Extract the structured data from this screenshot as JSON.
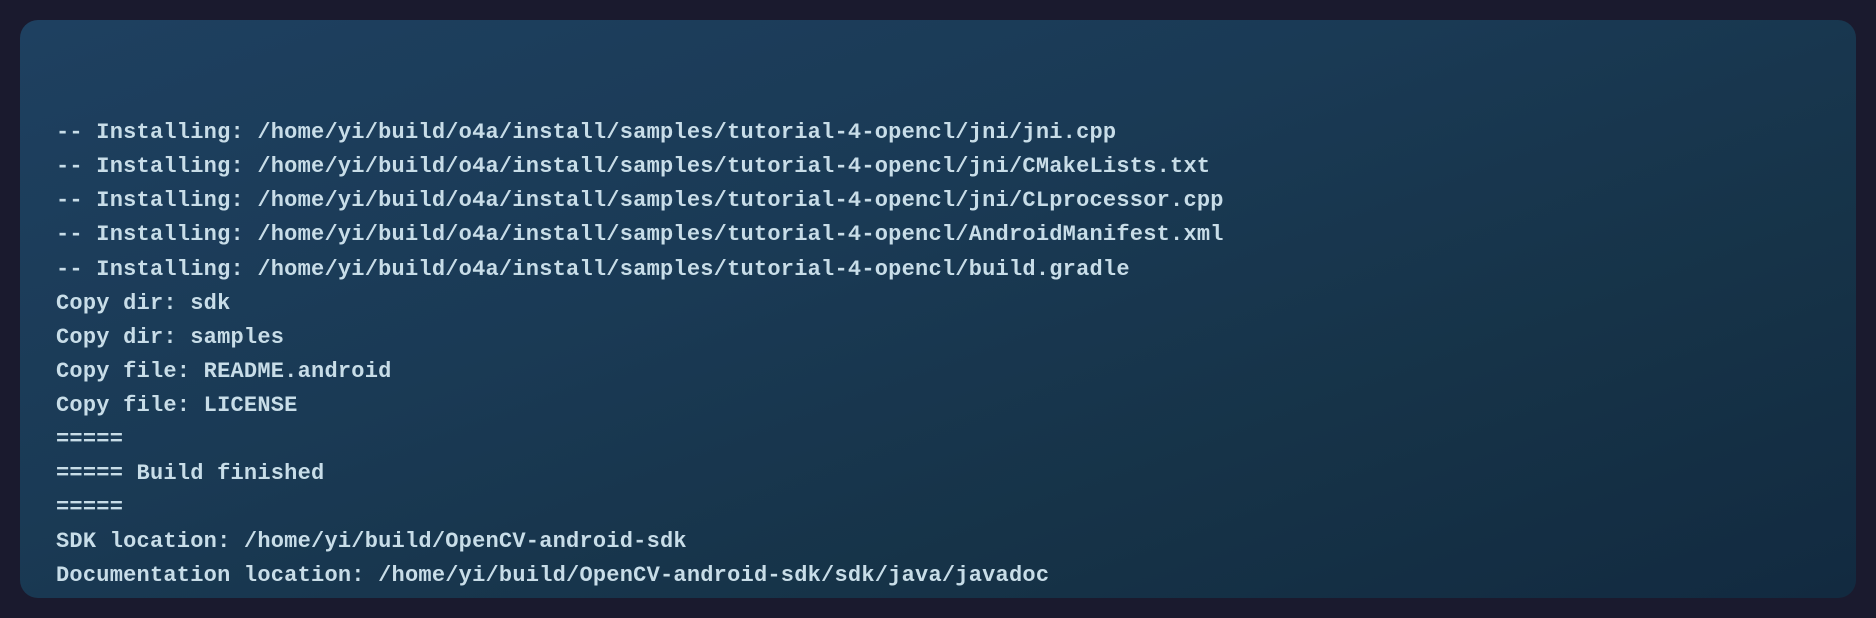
{
  "terminal": {
    "bg_color": "#1a3a55",
    "lines": [
      "-- Installing: /home/yi/build/o4a/install/samples/tutorial-4-opencl/jni/jni.cpp",
      "-- Installing: /home/yi/build/o4a/install/samples/tutorial-4-opencl/jni/CMakeLists.txt",
      "-- Installing: /home/yi/build/o4a/install/samples/tutorial-4-opencl/jni/CLprocessor.cpp",
      "-- Installing: /home/yi/build/o4a/install/samples/tutorial-4-opencl/AndroidManifest.xml",
      "-- Installing: /home/yi/build/o4a/install/samples/tutorial-4-opencl/build.gradle",
      "Copy dir: sdk",
      "Copy dir: samples",
      "Copy file: README.android",
      "Copy file: LICENSE",
      "=====",
      "===== Build finished",
      "=====",
      "SDK location: /home/yi/build/OpenCV-android-sdk",
      "Documentation location: /home/yi/build/OpenCV-android-sdk/sdk/java/javadoc"
    ]
  }
}
